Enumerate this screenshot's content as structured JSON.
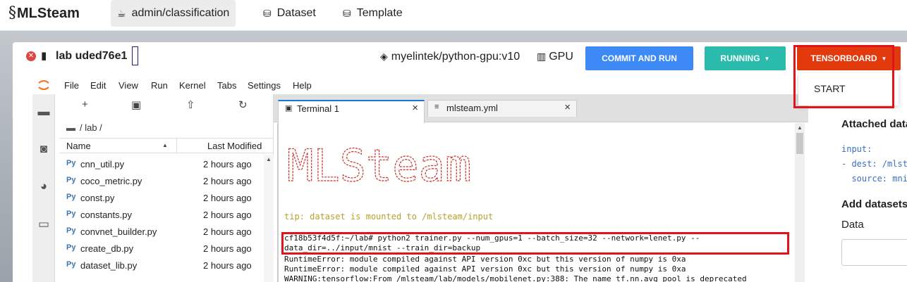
{
  "nav": {
    "logo": "MLSteam",
    "links": [
      {
        "label": "admin/classification",
        "icon": "mug-icon"
      },
      {
        "label": "Dataset",
        "icon": "database-icon"
      },
      {
        "label": "Template",
        "icon": "database-icon"
      }
    ]
  },
  "lab": {
    "title": "lab uded76e1",
    "image": "myelintek/python-gpu:v10",
    "gpu": "GPU",
    "buttons": {
      "commit": "COMMIT AND RUN",
      "running": "RUNNING",
      "tensorboard": "TENSORBOARD"
    },
    "dropdown_item": "START",
    "colors": {
      "commit": "#3d8af7",
      "running": "#2bbbad",
      "tensorboard": "#e23a0c",
      "highlight": "#e0141a"
    }
  },
  "menubar": [
    "File",
    "Edit",
    "View",
    "Run",
    "Kernel",
    "Tabs",
    "Settings",
    "Help"
  ],
  "filebrowser": {
    "breadcrumb": "/ lab /",
    "col_name": "Name",
    "col_modified": "Last Modified",
    "files": [
      {
        "name": "cnn_util.py",
        "modified": "2 hours ago"
      },
      {
        "name": "coco_metric.py",
        "modified": "2 hours ago"
      },
      {
        "name": "const.py",
        "modified": "2 hours ago"
      },
      {
        "name": "constants.py",
        "modified": "2 hours ago"
      },
      {
        "name": "convnet_builder.py",
        "modified": "2 hours ago"
      },
      {
        "name": "create_db.py",
        "modified": "2 hours ago"
      },
      {
        "name": "dataset_lib.py",
        "modified": "2 hours ago"
      }
    ]
  },
  "tabs": [
    {
      "label": "Terminal 1",
      "active": true
    },
    {
      "label": "mlsteam.yml",
      "active": false
    }
  ],
  "terminal": {
    "banner": "MLSteam",
    "tip": "tip: dataset is mounted to /mlsteam/input",
    "command": "cf18b53f4d5f:~/lab# python2 trainer.py --num_gpus=1 --batch_size=32 --network=lenet.py --data_dir=../input/mnist --train_dir=backup",
    "output": [
      "RuntimeError: module compiled against API version 0xc but this version of numpy is 0xa",
      "RuntimeError: module compiled against API version 0xc but this version of numpy is 0xa",
      "WARNING:tensorflow:From /mlsteam/lab/models/mobilenet.py:388: The name tf.nn.avg_pool is deprecated"
    ]
  },
  "sidepanel": {
    "attached_title": "Attached data",
    "yaml": [
      "input:",
      "- dest: /mlsteam/input",
      "  source: mnist"
    ],
    "add_title": "Add datasets",
    "data_label": "Data"
  }
}
